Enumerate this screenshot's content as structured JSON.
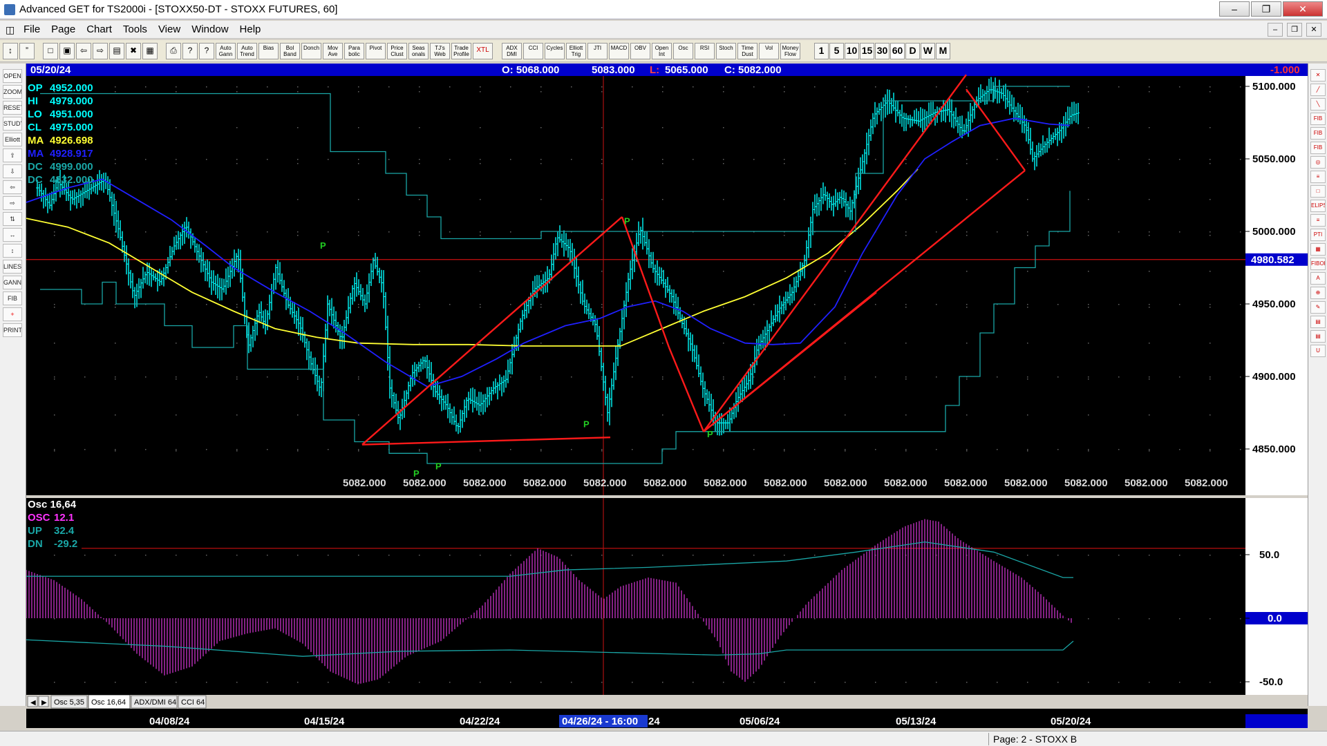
{
  "window": {
    "title": "Advanced GET for TS2000i - [STOXX50-DT - STOXX FUTURES, 60]",
    "buttons": [
      "–",
      "❐",
      "✕"
    ]
  },
  "menu": {
    "items": [
      "File",
      "Page",
      "Chart",
      "Tools",
      "View",
      "Window",
      "Help"
    ],
    "mdi_buttons": [
      "–",
      "❐",
      "✕"
    ]
  },
  "toolbar": {
    "study_buttons": [
      "Auto Gann",
      "Auto Trend",
      "Bias",
      "Bol Band",
      "Donch",
      "Mov Ave",
      "Para bolic",
      "Pivot",
      "Price Clust",
      "Seas onals",
      "TJ's Web",
      "Trade Profile",
      "XTL",
      "ADX DMI",
      "CCI",
      "Cycles",
      "Elliott Trig",
      "JTI",
      "MACD",
      "OBV",
      "Open Int",
      "Osc",
      "RSI",
      "Stoch",
      "Time Dust",
      "Vol",
      "Money Flow"
    ],
    "periods": [
      "1",
      "5",
      "10",
      "15",
      "30",
      "60",
      "D",
      "W",
      "M"
    ],
    "active_period": "60"
  },
  "left_tools": [
    "OPEN",
    "ZOOM",
    "RESET",
    "STUDY",
    "Elliott",
    "⇧",
    "⇩",
    "⇦",
    "⇨",
    "⇅",
    "↔",
    "↕",
    "LINES",
    "GANN",
    "FIB",
    "+",
    "PRINT"
  ],
  "right_tools": [
    "✕",
    "╱",
    "╲",
    "FIB RET",
    "FIB EXT",
    "FIB TIME",
    "◎",
    "≡",
    "□",
    "ELIPS",
    "≡",
    "PTI",
    "▦",
    "FIBOB",
    "A",
    "⊕",
    "✎",
    "▤",
    "▤",
    "U"
  ],
  "header_bar": {
    "date": "05/20/24",
    "open": "O: 5068.000",
    "high": "5083.000",
    "low_label": "L:",
    "low": "5065.000",
    "close": "C: 5082.000",
    "change": "-1.000"
  },
  "legend": [
    {
      "label": "OP",
      "value": "4952.000",
      "color": "#00ffff"
    },
    {
      "label": "HI",
      "value": "4979.000",
      "color": "#00ffff"
    },
    {
      "label": "LO",
      "value": "4951.000",
      "color": "#00ffff"
    },
    {
      "label": "CL",
      "value": "4975.000",
      "color": "#00ffff"
    },
    {
      "label": "MA",
      "value": "4926.698",
      "color": "#ffff33"
    },
    {
      "label": "MA",
      "value": "4928.917",
      "color": "#2020ff"
    },
    {
      "label": "DC",
      "value": "4999.000",
      "color": "#1aa7a7"
    },
    {
      "label": "DC",
      "value": "4832.000",
      "color": "#1aa7a7"
    }
  ],
  "price_axis": {
    "ticks": [
      "5100.000",
      "5050.000",
      "5000.000",
      "4950.000",
      "4900.000",
      "4850.000"
    ],
    "current_marker": "4980.582"
  },
  "bottom_labels": [
    "5082.000",
    "5082.000",
    "5082.000",
    "5082.000",
    "5082.000",
    "5082.000",
    "5082.000",
    "5082.000",
    "5082.000",
    "5082.000",
    "5082.000",
    "5082.000",
    "5082.000",
    "5082.000",
    "5082.000"
  ],
  "pivots": [
    "P",
    "P",
    "P",
    "P",
    "P",
    "P"
  ],
  "oscillator": {
    "title": "Osc 16,64",
    "legend": [
      {
        "label": "OSC",
        "value": "12.1",
        "color": "#ff33ff"
      },
      {
        "label": "UP",
        "value": "32.4",
        "color": "#1aa7a7"
      },
      {
        "label": "DN",
        "value": "-29.2",
        "color": "#1aa7a7"
      }
    ],
    "ticks": [
      "50.0",
      "0.0",
      "-50.0"
    ]
  },
  "tabs": [
    "Osc 5,35",
    "Osc 16,64",
    "ADX/DMI 64",
    "CCI 64"
  ],
  "active_tab": "Osc 16,64",
  "date_axis": {
    "labels": [
      "04/08/24",
      "04/15/24",
      "04/22/24",
      "05/06/24",
      "05/13/24",
      "05/20/24"
    ],
    "cursor_label": "04/26/24 - 16:00",
    "cursor_suffix": "24"
  },
  "status": {
    "page": "Page: 2 - STOXX B"
  },
  "colors": {
    "chart_bg": "#000000",
    "bars": "#00ffff",
    "ma_fast": "#2020ff",
    "ma_slow": "#ffff33",
    "donchian": "#1aa7a7",
    "trendlines": "#ff1a1a",
    "osc": "#cc33cc",
    "axis_marker": "#0000cc"
  }
}
